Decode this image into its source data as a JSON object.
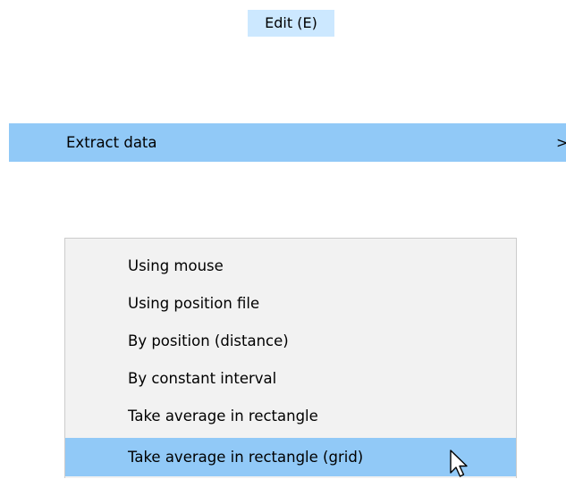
{
  "edit_menu": {
    "title": "Edit (E)"
  },
  "extract_data": {
    "label": "Extract data",
    "submenu_arrow": ">"
  },
  "submenu": {
    "items": [
      {
        "label": "Using mouse"
      },
      {
        "label": "Using position file"
      },
      {
        "label": "By position (distance)"
      },
      {
        "label": "By constant interval"
      },
      {
        "label": "Take average in rectangle"
      },
      {
        "label": "Take average in rectangle (grid)",
        "highlighted": true
      }
    ]
  },
  "cursor": {
    "icon": "arrow-cursor-icon"
  },
  "colors": {
    "title_highlight": "#cce8ff",
    "row_highlight": "#91c9f7",
    "submenu_background": "#f2f2f2",
    "submenu_border": "#cccccc"
  }
}
